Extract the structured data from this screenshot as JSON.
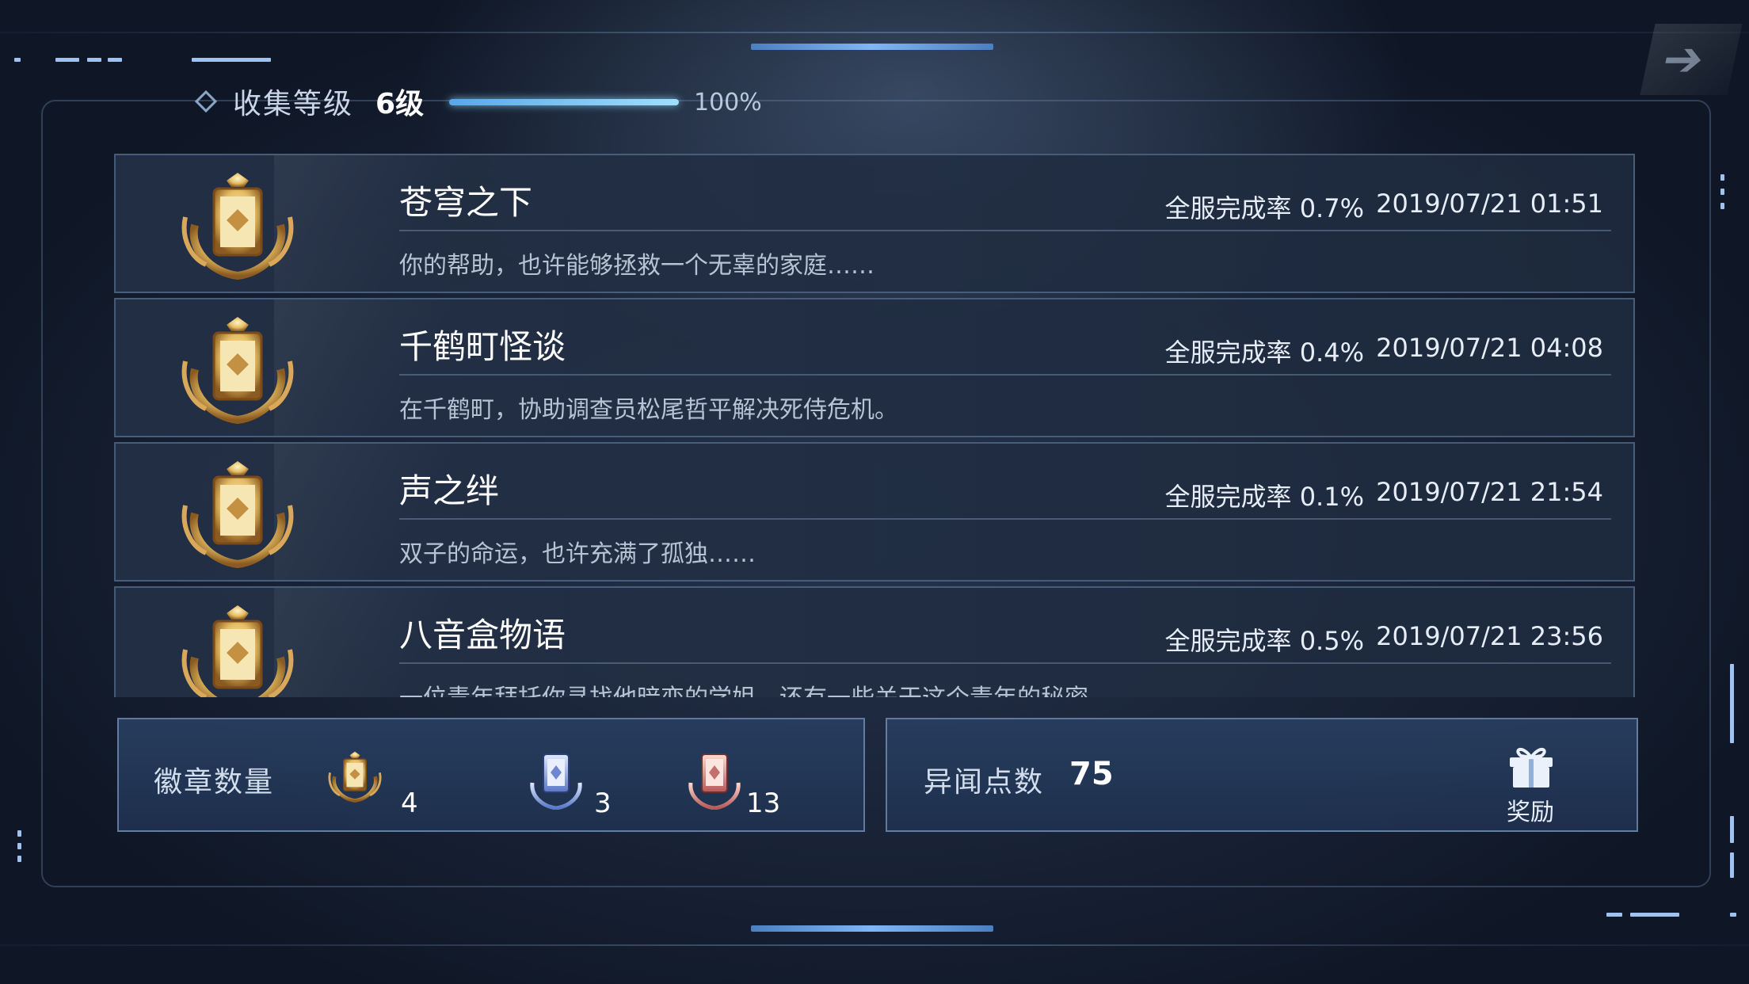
{
  "header": {
    "level_label": "收集等级",
    "level_value": "6级",
    "progress_text": "100%",
    "progress_fraction": 1.0
  },
  "items": [
    {
      "title": "苍穹之下",
      "rate": "全服完成率 0.7%",
      "date": "2019/07/21 01:51",
      "desc": "你的帮助，也许能够拯救一个无辜的家庭……",
      "medal": "gold-medal-icon"
    },
    {
      "title": "千鹤町怪谈",
      "rate": "全服完成率 0.4%",
      "date": "2019/07/21 04:08",
      "desc": "在千鹤町，协助调查员松尾哲平解决死侍危机。",
      "medal": "gold-medal-icon"
    },
    {
      "title": "声之绊",
      "rate": "全服完成率 0.1%",
      "date": "2019/07/21 21:54",
      "desc": "双子的命运，也许充满了孤独……",
      "medal": "gold-medal-icon"
    },
    {
      "title": "八音盒物语",
      "rate": "全服完成率 0.5%",
      "date": "2019/07/21 23:56",
      "desc": "一位青年拜托你寻找他暗恋的学姐，还有一些关于这个青年的秘密……",
      "medal": "gold-medal-icon"
    }
  ],
  "badges": {
    "label": "徽章数量",
    "gold_count": "4",
    "silver_count": "3",
    "bronze_count": "13"
  },
  "points": {
    "label": "异闻点数",
    "value": "75",
    "reward_label": "奖励"
  },
  "colors": {
    "accent": "#7fb6f5",
    "gold": "#d9b25e",
    "panel": "#233b5e"
  }
}
